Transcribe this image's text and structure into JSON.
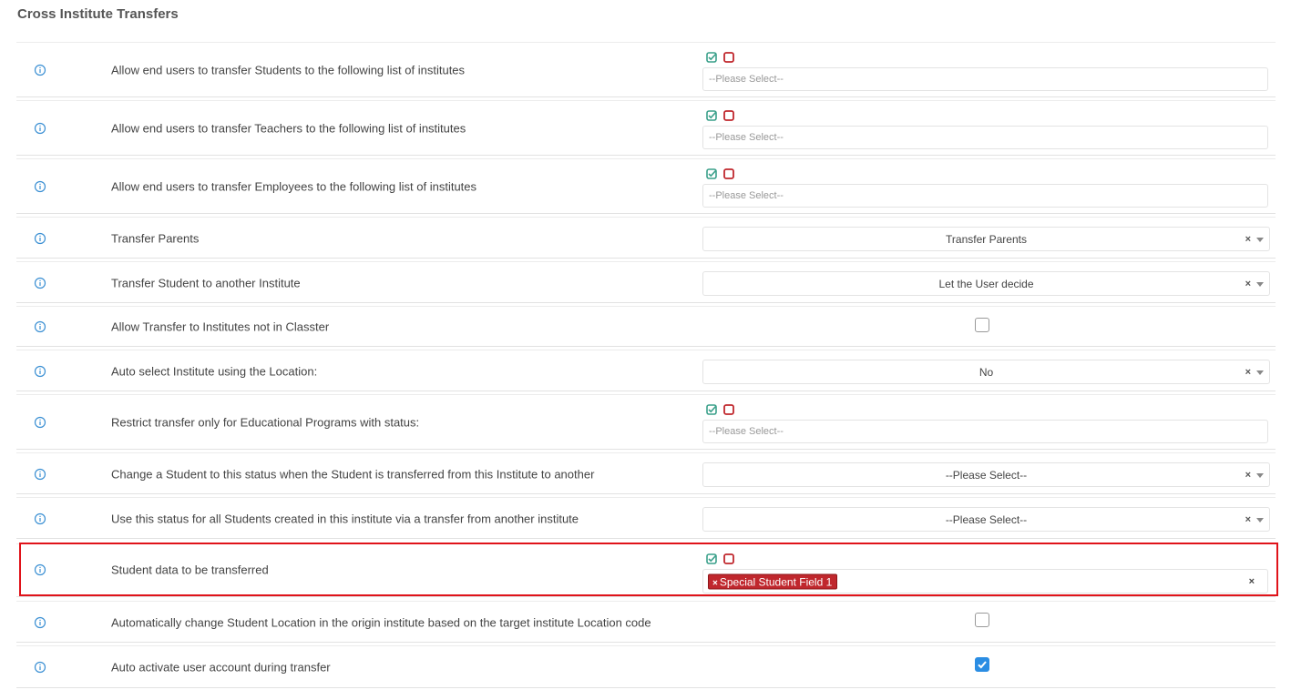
{
  "section": {
    "title": "Cross Institute Transfers"
  },
  "rows": [
    {
      "label": "Allow end users to transfer Students to the following list of institutes",
      "placeholder": "--Please Select--"
    },
    {
      "label": "Allow end users to transfer Teachers to the following list of institutes",
      "placeholder": "--Please Select--"
    },
    {
      "label": "Allow end users to transfer Employees to the following list of institutes",
      "placeholder": "--Please Select--"
    },
    {
      "label": "Transfer Parents",
      "value": "Transfer Parents"
    },
    {
      "label": "Transfer Student to another Institute",
      "value": "Let the User decide"
    },
    {
      "label": "Allow Transfer to Institutes not in Classter",
      "checked": false
    },
    {
      "label": "Auto select Institute using the Location:",
      "value": "No"
    },
    {
      "label": "Restrict transfer only for Educational Programs with status:",
      "placeholder": "--Please Select--"
    },
    {
      "label": "Change a Student to this status when the Student is transferred from this Institute to another",
      "value": "--Please Select--"
    },
    {
      "label": "Use this status for all Students created in this institute via a transfer from another institute",
      "value": "--Please Select--"
    },
    {
      "label": "Student data to be transferred",
      "tag": "Special Student Field 1"
    },
    {
      "label": "Automatically change Student Location in the origin institute based on the target institute Location code",
      "checked": false
    },
    {
      "label": "Auto activate user account during transfer",
      "checked": true
    }
  ],
  "glyphs": {
    "clear": "×",
    "tag_remove": "×"
  },
  "colors": {
    "select_all": "#3aa08a",
    "deselect_all": "#c0272d",
    "info_icon": "#3a8fd3",
    "tag_bg": "#c0272d",
    "highlight": "#e0131a",
    "checkbox_checked": "#2b8de3"
  }
}
